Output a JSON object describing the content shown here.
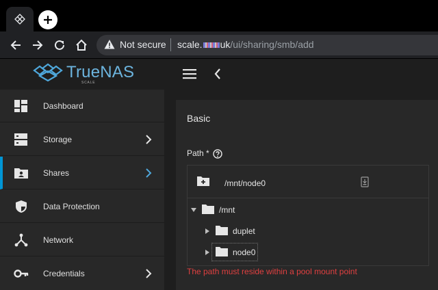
{
  "browser": {
    "security_label": "Not secure",
    "url_host": "scale.",
    "url_host_obscured": "uk",
    "url_path": "/ui/sharing/smb/add",
    "tab_icon": "truenas-favicon",
    "new_tab_icon": "plus-icon"
  },
  "app": {
    "logo_text": "TrueNAS",
    "logo_sub": "SCALE",
    "accent_color": "#0095d5"
  },
  "sidebar": {
    "items": [
      {
        "label": "Dashboard",
        "icon": "dashboard-icon",
        "has_chevron": false,
        "active": false
      },
      {
        "label": "Storage",
        "icon": "storage-icon",
        "has_chevron": true,
        "active": false
      },
      {
        "label": "Shares",
        "icon": "shares-folder-icon",
        "has_chevron": true,
        "active": true
      },
      {
        "label": "Data Protection",
        "icon": "shield-icon",
        "has_chevron": false,
        "active": false
      },
      {
        "label": "Network",
        "icon": "network-icon",
        "has_chevron": false,
        "active": false
      },
      {
        "label": "Credentials",
        "icon": "key-icon",
        "has_chevron": true,
        "active": false
      }
    ]
  },
  "form": {
    "section_title": "Basic",
    "path_label": "Path *",
    "path_value": "/mnt/node0",
    "tree": [
      {
        "label": "/mnt",
        "expanded": true
      },
      {
        "label": "duplet",
        "expanded": false
      },
      {
        "label": "node0",
        "expanded": false,
        "focused": true
      }
    ],
    "error": "The path must reside within a pool mount point",
    "error_color": "#e04040"
  }
}
